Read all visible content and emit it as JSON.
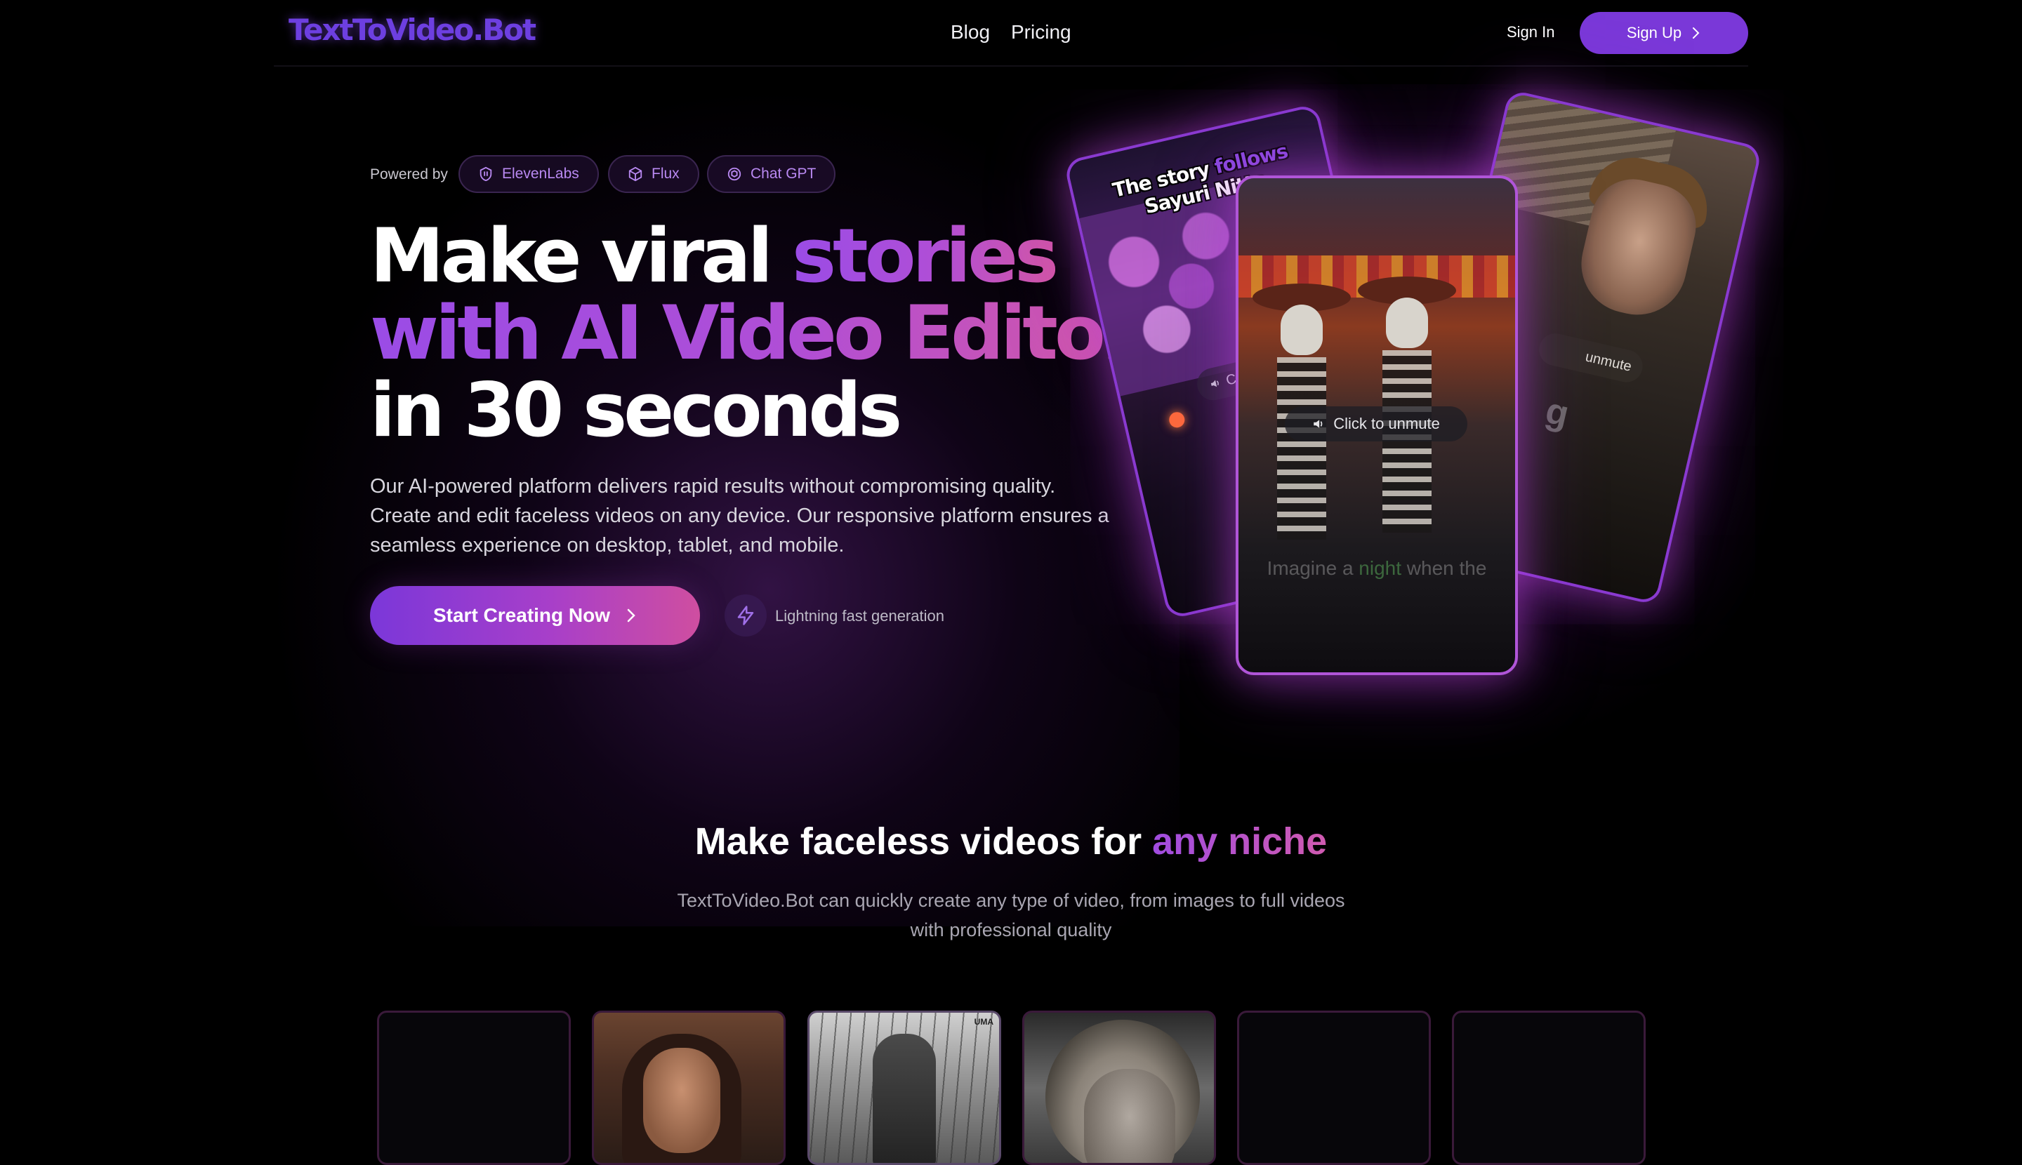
{
  "header": {
    "logo": "TextToVideo.Bot",
    "nav": [
      {
        "label": "Blog"
      },
      {
        "label": "Pricing"
      }
    ],
    "sign_in": "Sign In",
    "sign_up": "Sign Up"
  },
  "hero": {
    "powered_by": "Powered by",
    "partners": [
      {
        "label": "ElevenLabs",
        "icon": "elevenlabs-icon"
      },
      {
        "label": "Flux",
        "icon": "cube-icon"
      },
      {
        "label": "Chat GPT",
        "icon": "openai-icon"
      }
    ],
    "headline": {
      "line1_white": "Make viral ",
      "line1_grad": "stories",
      "line2_grad": "with AI Video Editor",
      "line3_white": "in 30 seconds"
    },
    "lead": "Our AI-powered platform delivers rapid results without compromising quality. Create and edit faceless videos on any device. Our responsive platform ensures a seamless experience on desktop, tablet, and mobile.",
    "cta": "Start Creating Now",
    "fast_label": "Lightning fast generation"
  },
  "phones": {
    "left_caption_1": "The story ",
    "left_caption_hl": "follows",
    "left_caption_2": " Sayuri Nitta",
    "left_unmute": "Clic",
    "center_unmute": "Click to unmute",
    "center_caption_1": "Imagine a ",
    "center_caption_hl": "night",
    "center_caption_2": " when the",
    "right_unmute": "unmute",
    "right_partial": "g"
  },
  "section_niche": {
    "title_white": "Make faceless videos for ",
    "title_grad": "any niche",
    "subtitle": "TextToVideo.Bot can quickly create any type of video, from images to full videos with professional quality",
    "card_tag": "UMA"
  },
  "colors": {
    "accent": "#7a38d8",
    "gradient_start": "#9a4ce6",
    "gradient_end": "#d457a6",
    "background": "#000000"
  }
}
